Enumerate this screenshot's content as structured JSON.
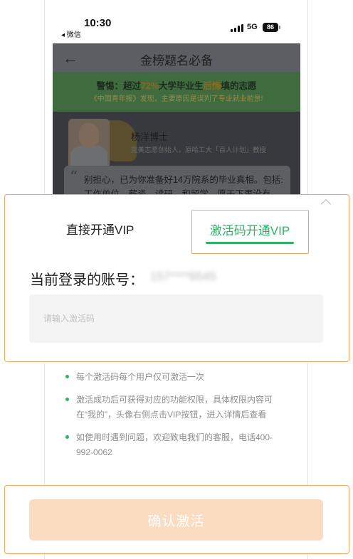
{
  "status_bar": {
    "time": "10:30",
    "back_app": "◂ 微信",
    "network": "5G",
    "battery": "86"
  },
  "page": {
    "nav_title": "金榜题名必备",
    "banner": {
      "warn_prefix": "警惕：超过",
      "warn_percent": "72%",
      "warn_mid": "大学毕业生",
      "warn_keyword": "后悔",
      "warn_suffix": "填的志愿",
      "subtext": "《中国青年报》发现，主要原因是误判了专业就业前景!"
    },
    "expert": {
      "name": "杨洋博士",
      "title": "完美志愿创始人，原哈工大「百人计划」教授",
      "quote": "别担心，已为你准备好14万院系的毕业真相。包括:工作单位、薪资、读研、和留学。愿天下再没有"
    }
  },
  "sheet": {
    "tab_direct": "直接开通VIP",
    "tab_code": "激活码开通VIP",
    "account_label": "当前登录的账号：",
    "account_value": "157****6545",
    "code_placeholder": "请输入激活码"
  },
  "notes": [
    "每个激活码每个用户仅可激活一次",
    "激活成功后可获得对应的功能权限，具体权限内容可在“我的”，头像右侧点击VIP按钮，进入详情后查看",
    "如使用时遇到问题，欢迎致电我们的客服，电话400-992-0062"
  ],
  "footer": {
    "confirm_label": "确认激活"
  },
  "colors": {
    "accent_green": "#2db266",
    "confirm_bg": "#fbdcc0",
    "highlight_border": "#f2a65e"
  }
}
